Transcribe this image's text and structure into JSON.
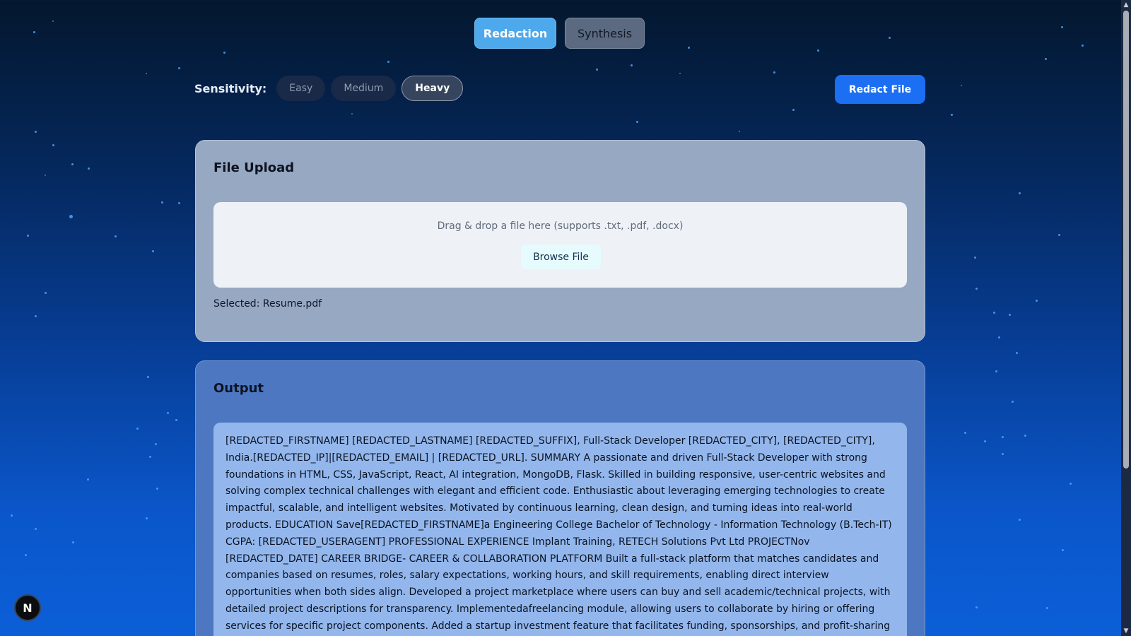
{
  "mode_tabs": {
    "redaction": "Redaction",
    "synthesis": "Synthesis",
    "active": "Redaction"
  },
  "sensitivity": {
    "label": "Sensitivity:",
    "options": [
      "Easy",
      "Medium",
      "Heavy"
    ],
    "selected": "Heavy"
  },
  "redact_button": "Redact File",
  "upload": {
    "title": "File Upload",
    "drop_hint": "Drag & drop a file here (supports .txt, .pdf, .docx)",
    "browse_label": "Browse File",
    "selected": "Selected: Resume.pdf"
  },
  "output": {
    "title": "Output",
    "text": "[REDACTED_FIRSTNAME] [REDACTED_LASTNAME] [REDACTED_SUFFIX], Full-Stack Developer [REDACTED_CITY], [REDACTED_CITY], India.[REDACTED_IP]|[REDACTED_EMAIL] | [REDACTED_URL]. SUMMARY A passionate and driven Full-Stack Developer with strong foundations in HTML, CSS, JavaScript, React, AI integration, MongoDB, Flask. Skilled in building responsive, user-centric websites and solving complex technical challenges with elegant and efficient code. Enthusiastic about leveraging emerging technologies to create impactful, scalable, and intelligent websites. Motivated by continuous learning, clean design, and turning ideas into real-world products. EDUCATION Save[REDACTED_FIRSTNAME]a Engineering College Bachelor of Technology - Information Technology (B.Tech-IT) CGPA: [REDACTED_USERAGENT] PROFESSIONAL EXPERIENCE Implant Training, RETECH Solutions Pvt Ltd PROJECTNov [REDACTED_DATE] CAREER BRIDGE- CAREER & COLLABORATION PLATFORM Built a full-stack platform that matches candidates and companies based on resumes, roles, salary expectations, working hours, and skill requirements, enabling direct interview opportunities when both sides align. Developed a project marketplace where users can buy and sell academic/technical projects, with detailed project descriptions for transparency. Implementedafreelancing module, allowing users to collaborate by hiring or offering services for specific project components. Added a startup investment feature that facilitates funding, sponsorships, and profit-sharing agreements between investors and startups."
  },
  "badge_letter": "N",
  "colors": {
    "accent": "#1c6ef2",
    "tab_active": "#4ea8ec",
    "star": "#4fa3ff"
  }
}
